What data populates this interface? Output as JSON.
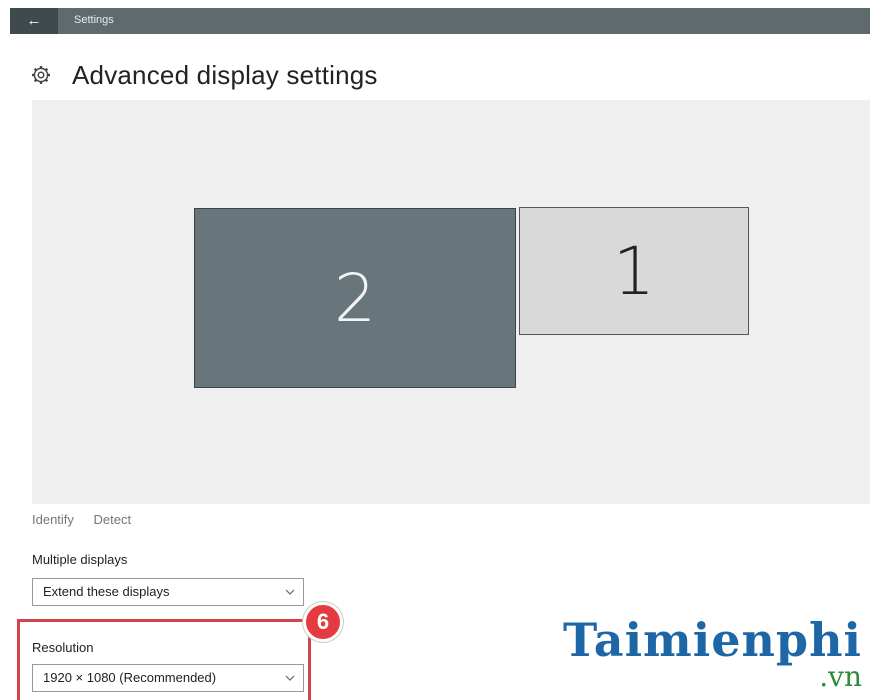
{
  "window": {
    "title": "Settings",
    "back_glyph": "←"
  },
  "page": {
    "title": "Advanced display settings",
    "icon": "gear-icon"
  },
  "arrangement": {
    "monitors": [
      {
        "number": "2",
        "color": "#68767b"
      },
      {
        "number": "1",
        "color": "#d9d9d9"
      }
    ],
    "actions": {
      "identify": "Identify",
      "detect": "Detect"
    }
  },
  "multiple_displays": {
    "label": "Multiple displays",
    "value": "Extend these displays"
  },
  "resolution": {
    "label": "Resolution",
    "value": "1920 × 1080 (Recommended)"
  },
  "annotation": {
    "step": "6",
    "color": "#e33b3f"
  },
  "watermark": {
    "brand": "Taimienphi",
    "tld": ".vn"
  }
}
